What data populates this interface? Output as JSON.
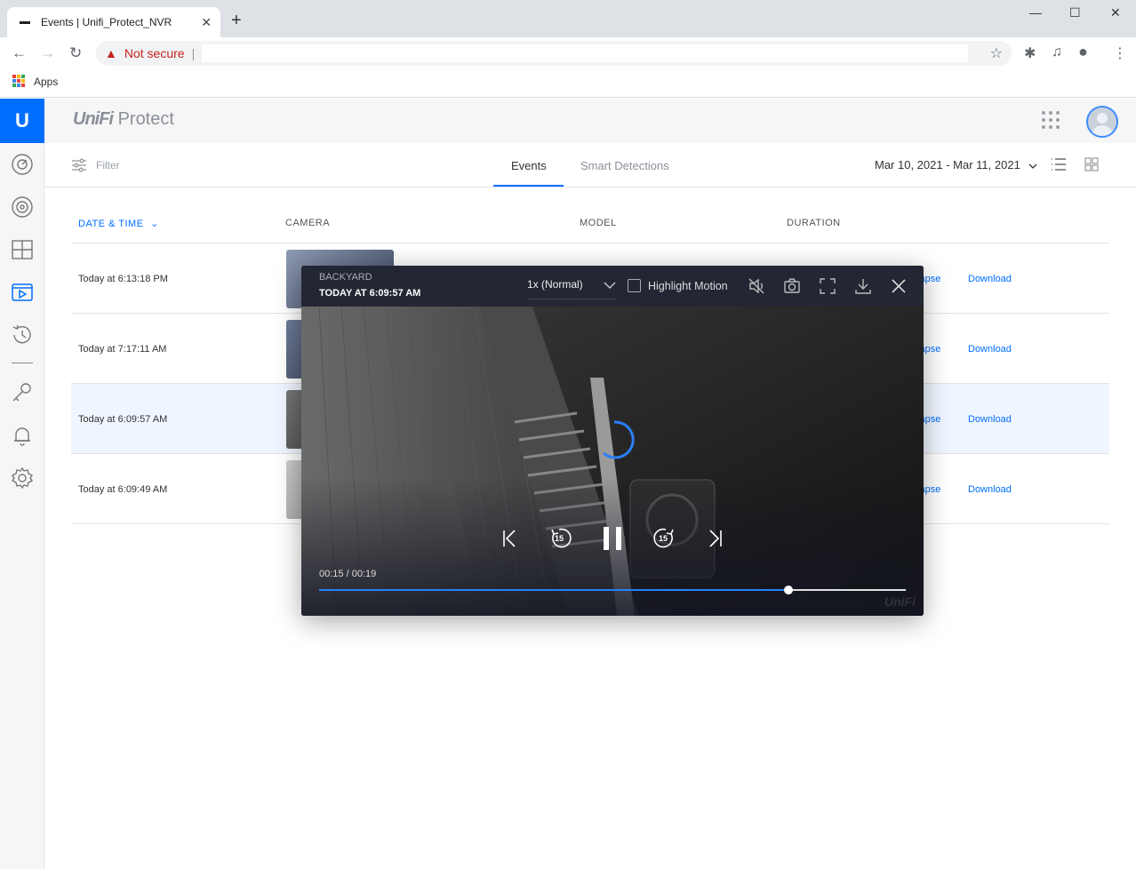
{
  "browser": {
    "tab_title": "Events | Unifi_Protect_NVR",
    "security_label": "Not secure",
    "bookmark_apps": "Apps"
  },
  "header": {
    "brand_unifi": "UniFi",
    "brand_protect": "Protect"
  },
  "toolbar": {
    "filter_label": "Filter",
    "tabs": [
      {
        "label": "Events",
        "active": true
      },
      {
        "label": "Smart Detections",
        "active": false
      }
    ],
    "date_range": "Mar 10, 2021 - Mar 11, 2021"
  },
  "table": {
    "columns": [
      "DATE & TIME",
      "CAMERA",
      "MODEL",
      "DURATION"
    ],
    "rows": [
      {
        "time": "Today at 6:13:18 PM",
        "timelapse": "Timelapse",
        "download": "Download"
      },
      {
        "time": "Today at 7:17:11 AM",
        "timelapse": "Timelapse",
        "download": "Download"
      },
      {
        "time": "Today at 6:09:57 AM",
        "timelapse": "Timelapse",
        "download": "Download",
        "selected": true
      },
      {
        "time": "Today at 6:09:49 AM",
        "timelapse": "Timelapse",
        "download": "Download"
      }
    ]
  },
  "player": {
    "camera_name": "BACKYARD",
    "timestamp": "TODAY AT 6:09:57 AM",
    "speed": "1x (Normal)",
    "highlight_motion": "Highlight Motion",
    "highlight_motion_checked": false,
    "skip_seconds": "15",
    "timecode": "00:15 / 00:19",
    "progress_fraction": 0.8,
    "watermark": "UniFi"
  },
  "colors": {
    "accent": "#006fff",
    "sidebar_bg": "#f6f6f6",
    "modal_bg": "#1c1f2a"
  },
  "icons": {
    "sidebar": [
      "dashboard-icon",
      "cameras-icon",
      "liveview-icon",
      "events-icon",
      "timelapse-icon",
      "integrations-icon",
      "notifications-icon",
      "settings-icon"
    ]
  }
}
